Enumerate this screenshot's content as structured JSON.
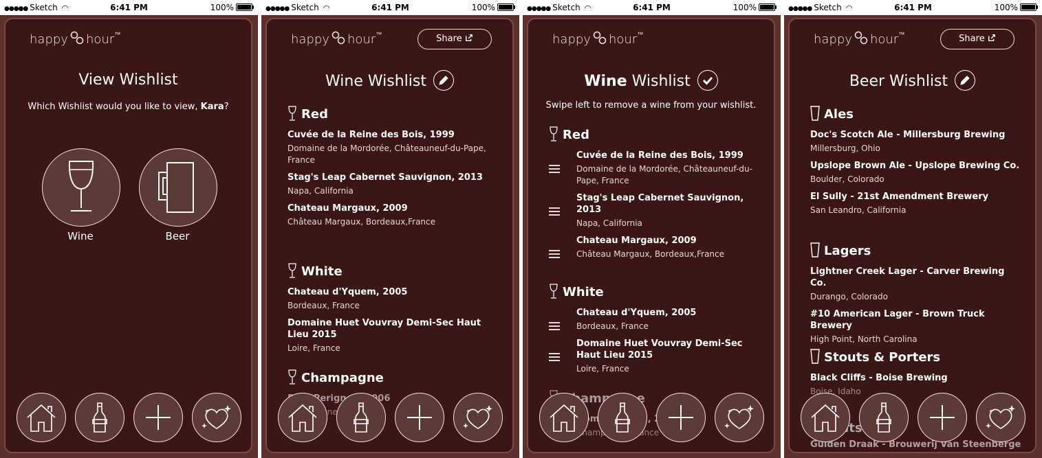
{
  "status_bar": {
    "carrier": "Sketch",
    "time": "6:41 PM",
    "battery": "100%",
    "signal_dots": "●●●●●"
  },
  "brand": {
    "name": "happy",
    "name2": "hour",
    "tm": "™"
  },
  "colors": {
    "background": "#3a1616",
    "frame": "#5e2f2d",
    "button_fill": "#5c3a38"
  },
  "nav": {
    "items": [
      "home-icon",
      "bottle-icon",
      "add-icon",
      "heart-sparkle-icon"
    ]
  },
  "screen1": {
    "title": "View Wishlist",
    "prompt_prefix": "Which Wishlist would you like to view,",
    "prompt_name": "Kara",
    "prompt_suffix": "?",
    "wine_label": "Wine",
    "beer_label": "Beer"
  },
  "screen2": {
    "share_label": "Share",
    "title": "Wine Wishlist",
    "sections": [
      {
        "heading": "Red",
        "items": [
          {
            "name": "Cuvée de la Reine des Bois, 1999",
            "sub": "Domaine de la Mordorée, Châteauneuf-du-Pape, France"
          },
          {
            "name": "Stag's Leap Cabernet Sauvignon, 2013",
            "sub": "Napa, California"
          },
          {
            "name": "Chateau Margaux, 2009",
            "sub": "Château Margaux, Bordeaux,France"
          }
        ]
      },
      {
        "heading": "White",
        "items": [
          {
            "name": "Chateau d'Yquem, 2005",
            "sub": "Bordeaux, France"
          },
          {
            "name": "Domaine Huet Vouvray Demi-Sec Haut Lieu 2015",
            "sub": "Loire, France"
          }
        ]
      },
      {
        "heading": "Champagne",
        "items": [
          {
            "name": "Dom Perignon, 2006",
            "sub": "Champagne, France"
          }
        ]
      }
    ]
  },
  "screen3": {
    "title_bold": "Wine",
    "title_rest": " Wishlist",
    "instruction": "Swipe left to remove a wine from your wishlist."
  },
  "screen4": {
    "share_label": "Share",
    "title": "Beer Wishlist",
    "sections": [
      {
        "heading": "Ales",
        "items": [
          {
            "name": "Doc's Scotch Ale - Millersburg Brewing",
            "sub": "Millersburg, Ohio"
          },
          {
            "name": "Upslope Brown Ale - Upslope Brewing Co.",
            "sub": "Boulder, Colorado"
          },
          {
            "name": "El Sully - 21st Amendment Brewery",
            "sub": "San Leandro, California"
          }
        ]
      },
      {
        "heading": "Lagers",
        "items": [
          {
            "name": "Lightner Creek Lager - Carver Brewing Co.",
            "sub": "Durango, Colorado"
          },
          {
            "name": "#10 American Lager - Brown Truck Brewery",
            "sub": "High Point, North Carolina"
          }
        ]
      },
      {
        "heading": "Stouts & Porters",
        "items": [
          {
            "name": "Black Cliffs - Boise Brewing",
            "sub": "Boise, Idaho"
          }
        ]
      },
      {
        "heading": "Malts",
        "items": [
          {
            "name": "Gulden Draak - Brouwerij Van Steenberge",
            "sub": ""
          }
        ]
      }
    ]
  }
}
